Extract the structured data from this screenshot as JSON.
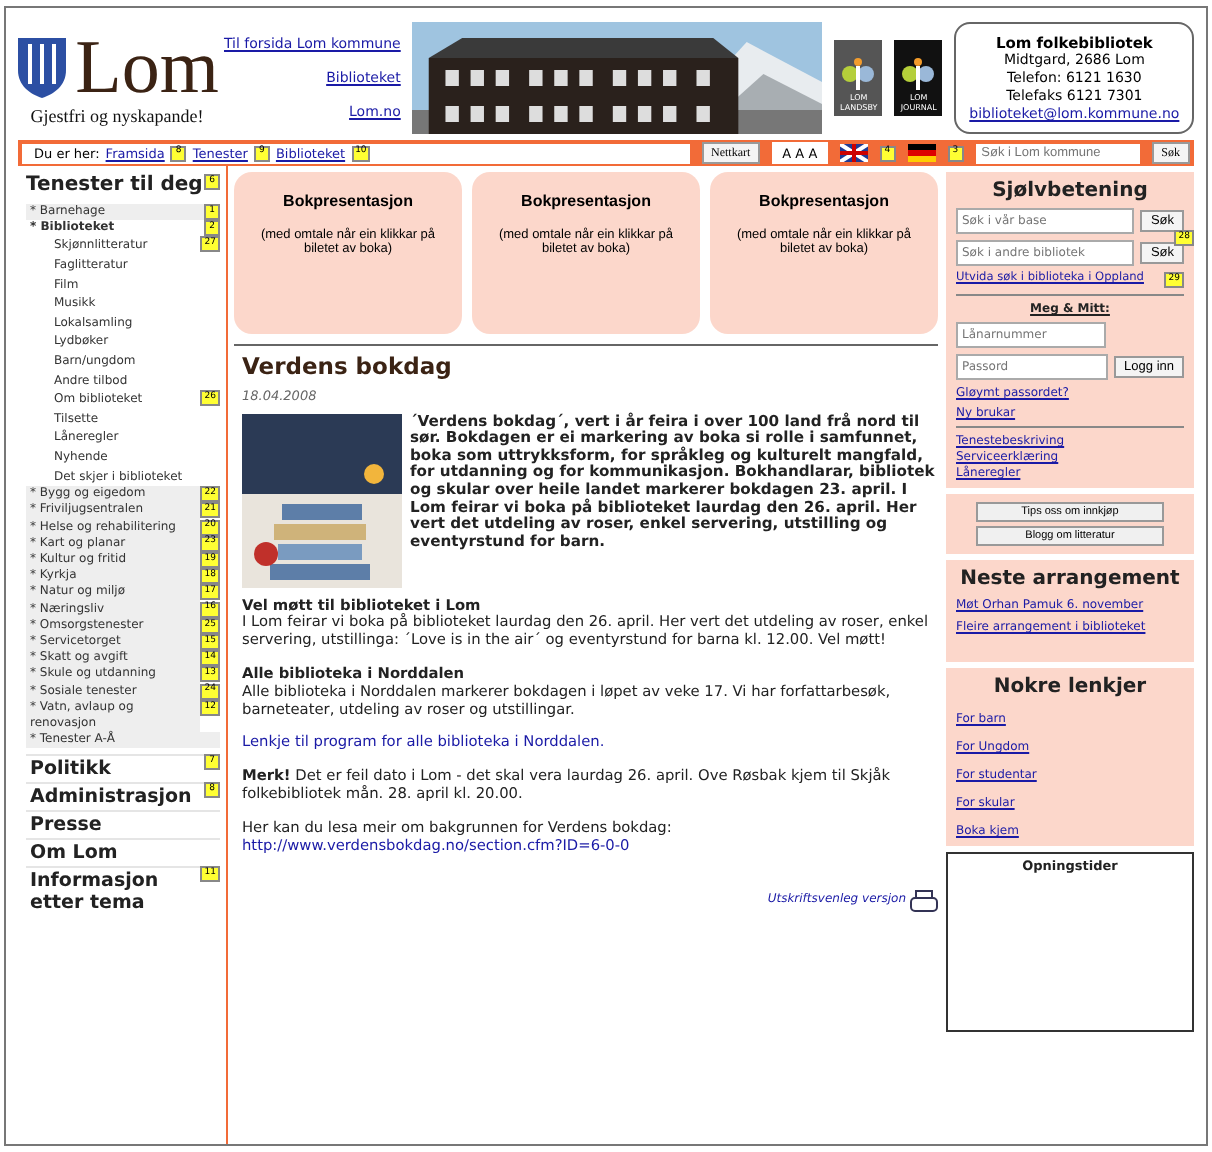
{
  "header": {
    "logo_text": "Lom",
    "slogan": "Gjestfri og nyskapande!",
    "links": [
      "Til forsida Lom kommune",
      "Biblioteket",
      "Lom.no"
    ],
    "badges": [
      {
        "text": "LOM",
        "sub": "LANDSBY"
      },
      {
        "text": "LOM",
        "sub": "JOURNAL"
      }
    ],
    "contact": {
      "name": "Lom folkebibliotek",
      "lines": [
        "Midtgard, 2686 Lom",
        "Telefon: 6121 1630",
        "Telefaks 6121 7301"
      ],
      "email": "biblioteket@lom.kommune.no"
    }
  },
  "nav": {
    "label": "Du er her:",
    "crumbs": [
      {
        "label": "Framsida",
        "marker": "8"
      },
      {
        "label": "Tenester",
        "marker": "9"
      },
      {
        "label": "Biblioteket",
        "marker": "10"
      }
    ],
    "map_button": "Nettkart",
    "text_size": "A A A",
    "flag_markers": [
      "4",
      "3"
    ],
    "search": {
      "placeholder": "Søk i Lom kommune",
      "button": "Søk"
    }
  },
  "sidebar": {
    "title": "Tenester til deg",
    "marker": "6",
    "items": [
      {
        "label": "* Barnehage",
        "marker": "1",
        "selected": false
      },
      {
        "label": "* Biblioteket",
        "marker": "2",
        "selected": true,
        "children": [
          {
            "label": "Skjønnlitteratur",
            "marker": "27"
          },
          {
            "label": "Faglitteratur"
          },
          {
            "label": "Film"
          },
          {
            "label": "Musikk"
          },
          {
            "label": "Lokalsamling"
          },
          {
            "label": "Lydbøker"
          },
          {
            "label": "Barn/ungdom"
          },
          {
            "label": "Andre tilbod"
          },
          {
            "label": "Om biblioteket",
            "marker": "26"
          },
          {
            "label": "Tilsette"
          },
          {
            "label": "Låneregler"
          },
          {
            "label": "Nyhende"
          },
          {
            "label": "Det skjer i biblioteket"
          }
        ]
      },
      {
        "label": "* Bygg og eigedom",
        "marker": "22",
        "selected": false
      },
      {
        "label": "* Friviljugsentralen",
        "marker": "21",
        "selected": false
      },
      {
        "label": "* Helse og rehabilitering",
        "marker": "20",
        "selected": false
      },
      {
        "label": "* Kart og planar",
        "marker": "23",
        "selected": false
      },
      {
        "label": "* Kultur og fritid",
        "marker": "19",
        "selected": false
      },
      {
        "label": "* Kyrkja",
        "marker": "18",
        "selected": false
      },
      {
        "label": "* Natur og miljø",
        "marker": "17",
        "selected": false
      },
      {
        "label": "* Næringsliv",
        "marker": "16",
        "selected": false
      },
      {
        "label": "* Omsorgstenester",
        "marker": "25",
        "selected": false
      },
      {
        "label": "* Servicetorget",
        "marker": "15",
        "selected": false
      },
      {
        "label": "* Skatt og avgift",
        "marker": "14",
        "selected": false
      },
      {
        "label": "* Skule og utdanning",
        "marker": "13",
        "selected": false
      },
      {
        "label": "* Sosiale tenester",
        "marker": "24",
        "selected": false
      },
      {
        "label": "* Vatn, avlaup og renovasjon",
        "marker": "12",
        "selected": false
      },
      {
        "label": "* Tenester A-Å",
        "selected": false
      }
    ],
    "sections": [
      {
        "label": "Politikk",
        "marker": "7"
      },
      {
        "label": "Administrasjon",
        "marker": "8"
      },
      {
        "label": "Presse"
      },
      {
        "label": "Om Lom"
      },
      {
        "label": "Informasjon etter tema",
        "marker": "11"
      }
    ]
  },
  "promos": [
    {
      "title": "Bokpresentasjon",
      "text": "(med omtale når ein klikkar på biletet av boka)"
    },
    {
      "title": "Bokpresentasjon",
      "text": "(med omtale når ein klikkar på biletet av boka)"
    },
    {
      "title": "Bokpresentasjon",
      "text": "(med omtale når ein klikkar på biletet av boka)"
    }
  ],
  "article": {
    "title": "Verdens bokdag",
    "date": "18.04.2008",
    "lead": "´Verdens bokdag´, vert i år feira i over 100 land frå nord til sør. Bokdagen er ei markering av boka si rolle i samfunnet, boka som uttrykksform, for språkleg og kulturelt mangfald, for utdanning og for kommunikasjon. Bokhandlarar, bibliotek og skular over heile landet markerer bokdagen 23. april. I Lom feirar vi boka på biblioteket laurdag den 26. april. Her vert det utdeling av roser, enkel servering, utstilling og eventyrstund for barn.",
    "sections": [
      {
        "heading": "Vel møtt til biblioteket i Lom",
        "text": "I Lom feirar vi boka på biblioteket laurdag den 26. april. Her vert det utdeling av roser, enkel servering, utstillinga: ´Love is in the air´ og eventyrstund for barna kl. 12.00. Vel møtt!"
      },
      {
        "heading": "Alle biblioteka i Norddalen",
        "text": "Alle biblioteka i Norddalen markerer bokdagen i løpet av veke 17. Vi har forfattarbesøk, barneteater, utdeling av roser og utstillingar."
      }
    ],
    "program_link": "Lenkje til program for alle biblioteka i Norddalen.",
    "note": "**Merk!** Det er feil dato i Lom - det skal vera laurdag 26. april. Ove Røsbak kjem til Skjåk folkebibliotek mån. 28. april kl. 20.00.",
    "more_text": "Her kan du lesa meir om bakgrunnen for Verdens bokdag:",
    "url": "http://www.verdensbokdag.no/section.cfm?ID=6-0-0",
    "print_link": "Utskriftsvenleg versjon"
  },
  "right": {
    "selfservice": {
      "title": "Sjølvbetening",
      "searches": [
        {
          "placeholder": "Søk i vår base",
          "button": "Søk"
        },
        {
          "placeholder": "Søk i andre bibliotek",
          "button": "Søk",
          "marker": "28"
        }
      ],
      "advanced_link": "Utvida søk i biblioteka i Oppland",
      "advanced_marker": "29",
      "login_title": "Meg & Mitt:",
      "login_fields": [
        {
          "placeholder": "Lånarnummer"
        },
        {
          "placeholder": "Passord"
        }
      ],
      "login_button": "Logg inn",
      "account_links": [
        "Gløymt passordet?",
        "Ny brukar"
      ],
      "info_links": [
        "Tenestebeskriving",
        "Serviceerklæring",
        "Låneregler"
      ]
    },
    "buttons": [
      "Tips oss om innkjøp",
      "Blogg om litteratur"
    ],
    "events": {
      "title": "Neste arrangement",
      "links": [
        "Møt Orhan Pamuk 6. november",
        "Fleire arrangement i biblioteket"
      ]
    },
    "links": {
      "title": "Nokre lenkjer",
      "items": [
        "For barn",
        "For Ungdom",
        "For studentar",
        "For skular",
        "Boka kjem"
      ]
    },
    "opening_title": "Opningstider"
  }
}
